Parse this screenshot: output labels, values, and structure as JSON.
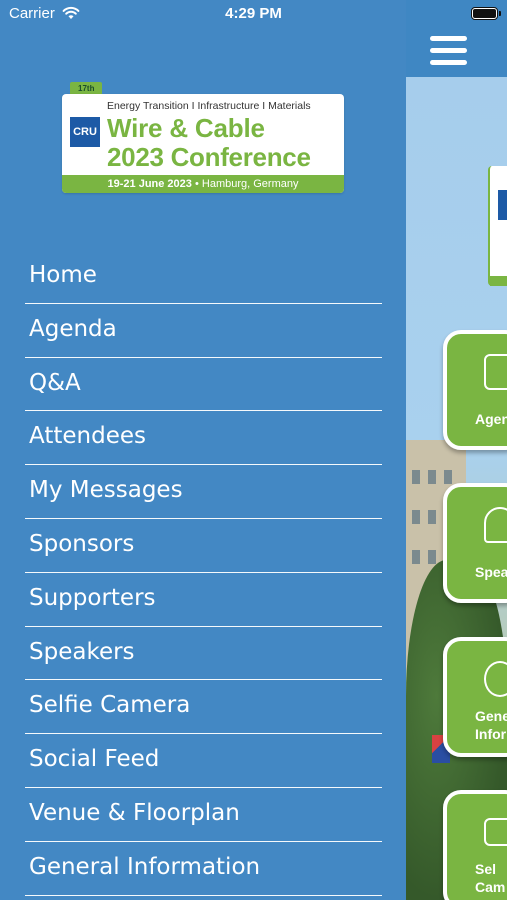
{
  "status_bar": {
    "carrier": "Carrier",
    "time": "4:29 PM"
  },
  "logo": {
    "edition": "17th",
    "tagline": "Energy Transition I Infrastructure I Materials",
    "brand": "CRU",
    "title_line1": "Wire & Cable",
    "title_line2": "2023 Conference",
    "dates": "19-21 June 2023",
    "location": "• Hamburg, Germany"
  },
  "menu": {
    "items": [
      {
        "label": "Home"
      },
      {
        "label": "Agenda"
      },
      {
        "label": "Q&A"
      },
      {
        "label": "Attendees"
      },
      {
        "label": "My Messages"
      },
      {
        "label": "Sponsors"
      },
      {
        "label": "Supporters"
      },
      {
        "label": "Speakers"
      },
      {
        "label": "Selfie Camera"
      },
      {
        "label": "Social Feed"
      },
      {
        "label": "Venue & Floorplan"
      },
      {
        "label": "General Information"
      }
    ]
  },
  "background_tiles": {
    "items": [
      {
        "label": "Agen",
        "icon": "clipboard-icon"
      },
      {
        "label": "Spea",
        "icon": "microphone-icon"
      },
      {
        "label_line1": "Gene",
        "label_line2": "Inform",
        "icon": "info-icon"
      },
      {
        "label_line1": "Sel",
        "label_line2": "Cam",
        "icon": "camera-icon"
      }
    ]
  },
  "colors": {
    "drawer_background": "#4388c4",
    "brand_green": "#7ab542",
    "brand_blue": "#1d5aa6",
    "menu_text": "#ffffff"
  }
}
